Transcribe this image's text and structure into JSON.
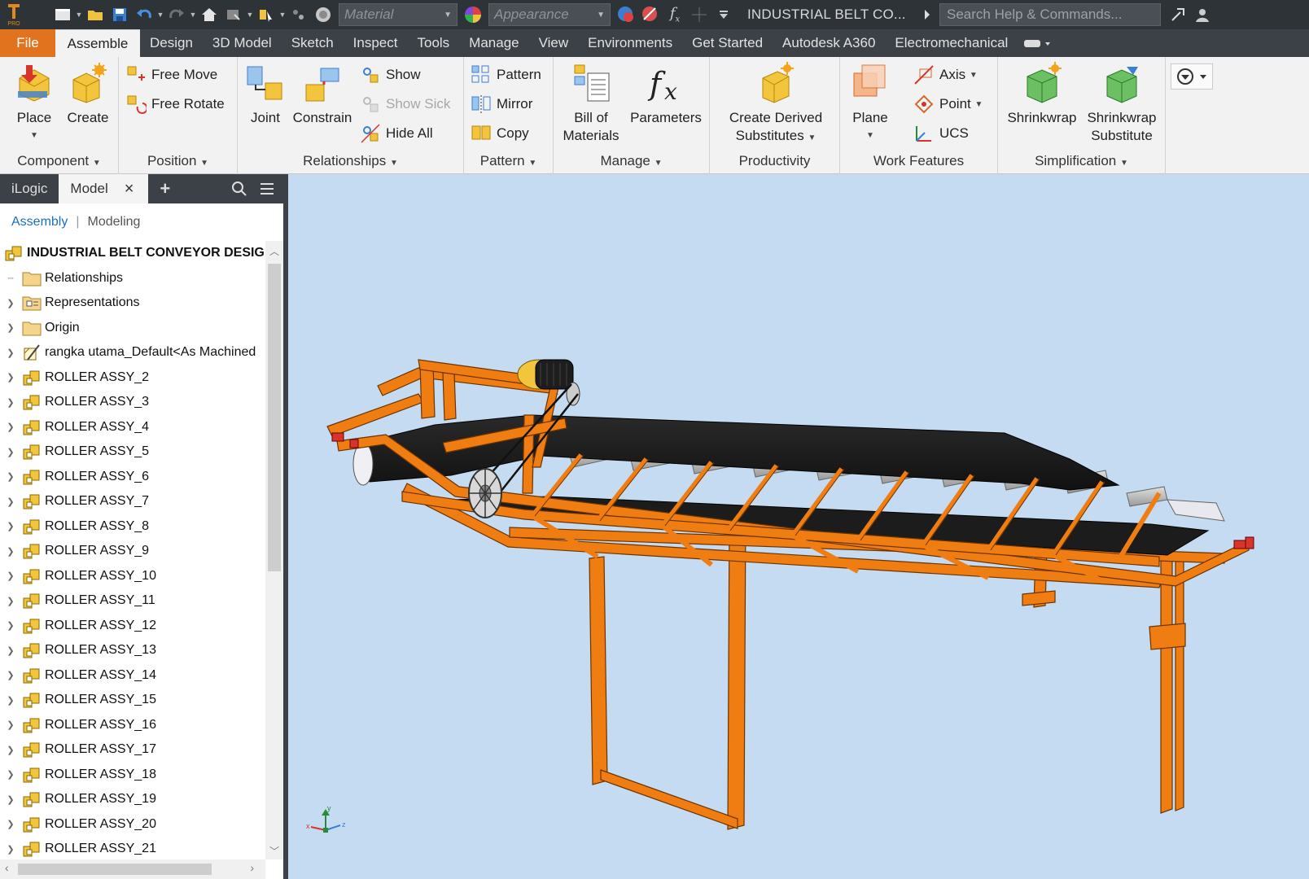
{
  "app": {
    "title": "INDUSTRIAL BELT CO...",
    "badge": "PRO"
  },
  "qat": {
    "material_placeholder": "Material",
    "appearance_placeholder": "Appearance",
    "search_placeholder": "Search Help & Commands...",
    "icons": [
      "new-icon",
      "open-icon",
      "save-icon",
      "undo-icon",
      "redo-icon",
      "home-icon",
      "update-icon",
      "select-icon",
      "color-wheel-icon",
      "appearance-override-icon",
      "clear-appearance-icon",
      "fx-icon"
    ]
  },
  "tabs": [
    {
      "label": "File"
    },
    {
      "label": "Assemble",
      "active": true
    },
    {
      "label": "Design"
    },
    {
      "label": "3D Model"
    },
    {
      "label": "Sketch"
    },
    {
      "label": "Inspect"
    },
    {
      "label": "Tools"
    },
    {
      "label": "Manage"
    },
    {
      "label": "View"
    },
    {
      "label": "Environments"
    },
    {
      "label": "Get Started"
    },
    {
      "label": "Autodesk A360"
    },
    {
      "label": "Electromechanical"
    }
  ],
  "ribbon": {
    "component": {
      "title": "Component",
      "place": "Place",
      "create": "Create"
    },
    "position": {
      "title": "Position",
      "free_move": "Free Move",
      "free_rotate": "Free Rotate"
    },
    "relationships": {
      "title": "Relationships",
      "joint": "Joint",
      "constrain": "Constrain",
      "show": "Show",
      "show_sick": "Show Sick",
      "hide_all": "Hide All"
    },
    "pattern": {
      "title": "Pattern",
      "pattern": "Pattern",
      "mirror": "Mirror",
      "copy": "Copy"
    },
    "manage": {
      "title": "Manage",
      "bom_line1": "Bill of",
      "bom_line2": "Materials",
      "parameters": "Parameters"
    },
    "productivity": {
      "title": "Productivity",
      "line1": "Create Derived",
      "line2": "Substitutes"
    },
    "work_features": {
      "title": "Work Features",
      "plane": "Plane",
      "axis": "Axis",
      "point": "Point",
      "ucs": "UCS"
    },
    "simplification": {
      "title": "Simplification",
      "shrinkwrap": "Shrinkwrap",
      "sub_line1": "Shrinkwrap",
      "sub_line2": "Substitute"
    }
  },
  "browser": {
    "tabs": {
      "ilogic": "iLogic",
      "model": "Model"
    },
    "sub": {
      "assembly": "Assembly",
      "modeling": "Modeling"
    },
    "tree": [
      {
        "label": "INDUSTRIAL BELT CONVEYOR DESIG",
        "type": "root"
      },
      {
        "label": "Relationships",
        "type": "folder"
      },
      {
        "label": "Representations",
        "type": "representations"
      },
      {
        "label": "Origin",
        "type": "folder"
      },
      {
        "label": "rangka utama_Default<As Machined",
        "type": "weldment"
      },
      {
        "label": "ROLLER ASSY_2",
        "type": "assembly"
      },
      {
        "label": "ROLLER ASSY_3",
        "type": "assembly"
      },
      {
        "label": "ROLLER ASSY_4",
        "type": "assembly"
      },
      {
        "label": "ROLLER ASSY_5",
        "type": "assembly"
      },
      {
        "label": "ROLLER ASSY_6",
        "type": "assembly"
      },
      {
        "label": "ROLLER ASSY_7",
        "type": "assembly"
      },
      {
        "label": "ROLLER ASSY_8",
        "type": "assembly"
      },
      {
        "label": "ROLLER ASSY_9",
        "type": "assembly"
      },
      {
        "label": "ROLLER ASSY_10",
        "type": "assembly"
      },
      {
        "label": "ROLLER ASSY_11",
        "type": "assembly"
      },
      {
        "label": "ROLLER ASSY_12",
        "type": "assembly"
      },
      {
        "label": "ROLLER ASSY_13",
        "type": "assembly"
      },
      {
        "label": "ROLLER ASSY_14",
        "type": "assembly"
      },
      {
        "label": "ROLLER ASSY_15",
        "type": "assembly"
      },
      {
        "label": "ROLLER ASSY_16",
        "type": "assembly"
      },
      {
        "label": "ROLLER ASSY_17",
        "type": "assembly"
      },
      {
        "label": "ROLLER ASSY_18",
        "type": "assembly"
      },
      {
        "label": "ROLLER ASSY_19",
        "type": "assembly"
      },
      {
        "label": "ROLLER ASSY_20",
        "type": "assembly"
      },
      {
        "label": "ROLLER ASSY_21",
        "type": "assembly"
      }
    ]
  },
  "viewport": {
    "background": "#c5dbf2",
    "frame_color": "#f07d12",
    "belt_color": "#1f1f1f",
    "roller_color": "#bfbfbf",
    "triad_axes": [
      "x",
      "y",
      "z"
    ]
  },
  "colors": {
    "accent": "#e2731e",
    "ribbon_bg": "#f2f2f2",
    "dark_ui": "#3b4147"
  }
}
